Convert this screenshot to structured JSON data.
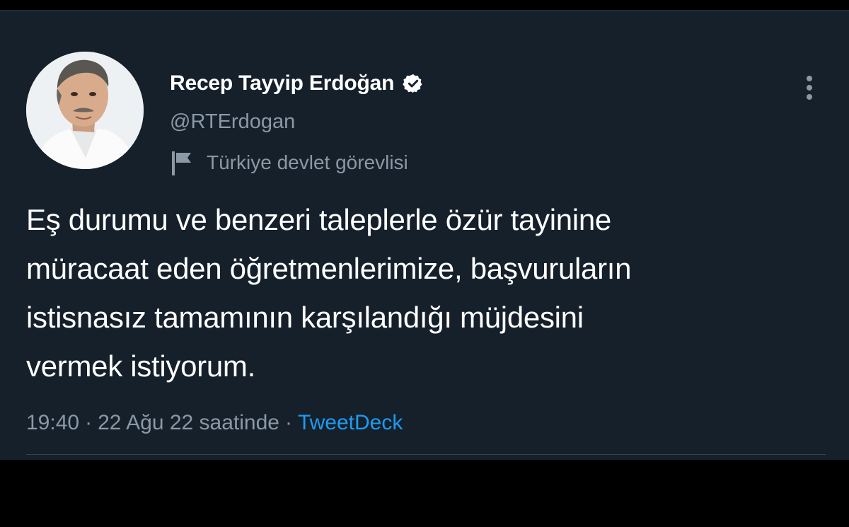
{
  "tweet": {
    "author": {
      "display_name": "Recep Tayyip Erdoğan",
      "handle": "@RTErdogan",
      "verified": true,
      "label": "Türkiye devlet görevlisi"
    },
    "text_lines": [
      "Eş durumu ve benzeri taleplerle özür tayinine",
      "müracaat eden öğretmenlerimize, başvuruların",
      "istisnasız tamamının karşılandığı müjdesini",
      "vermek istiyorum."
    ],
    "meta": {
      "time": "19:40",
      "separator": "·",
      "date": "22 Ağu 22 saatinde",
      "source": "TweetDeck"
    }
  },
  "icons": {
    "verified": "verified-badge-icon",
    "label_flag": "flag-icon",
    "more": "more-vertical-icon"
  },
  "colors": {
    "background": "#15202b",
    "primary_text": "#ffffff",
    "secondary_text": "#8b98a5",
    "link": "#1d9bf0",
    "divider": "#38444d"
  }
}
